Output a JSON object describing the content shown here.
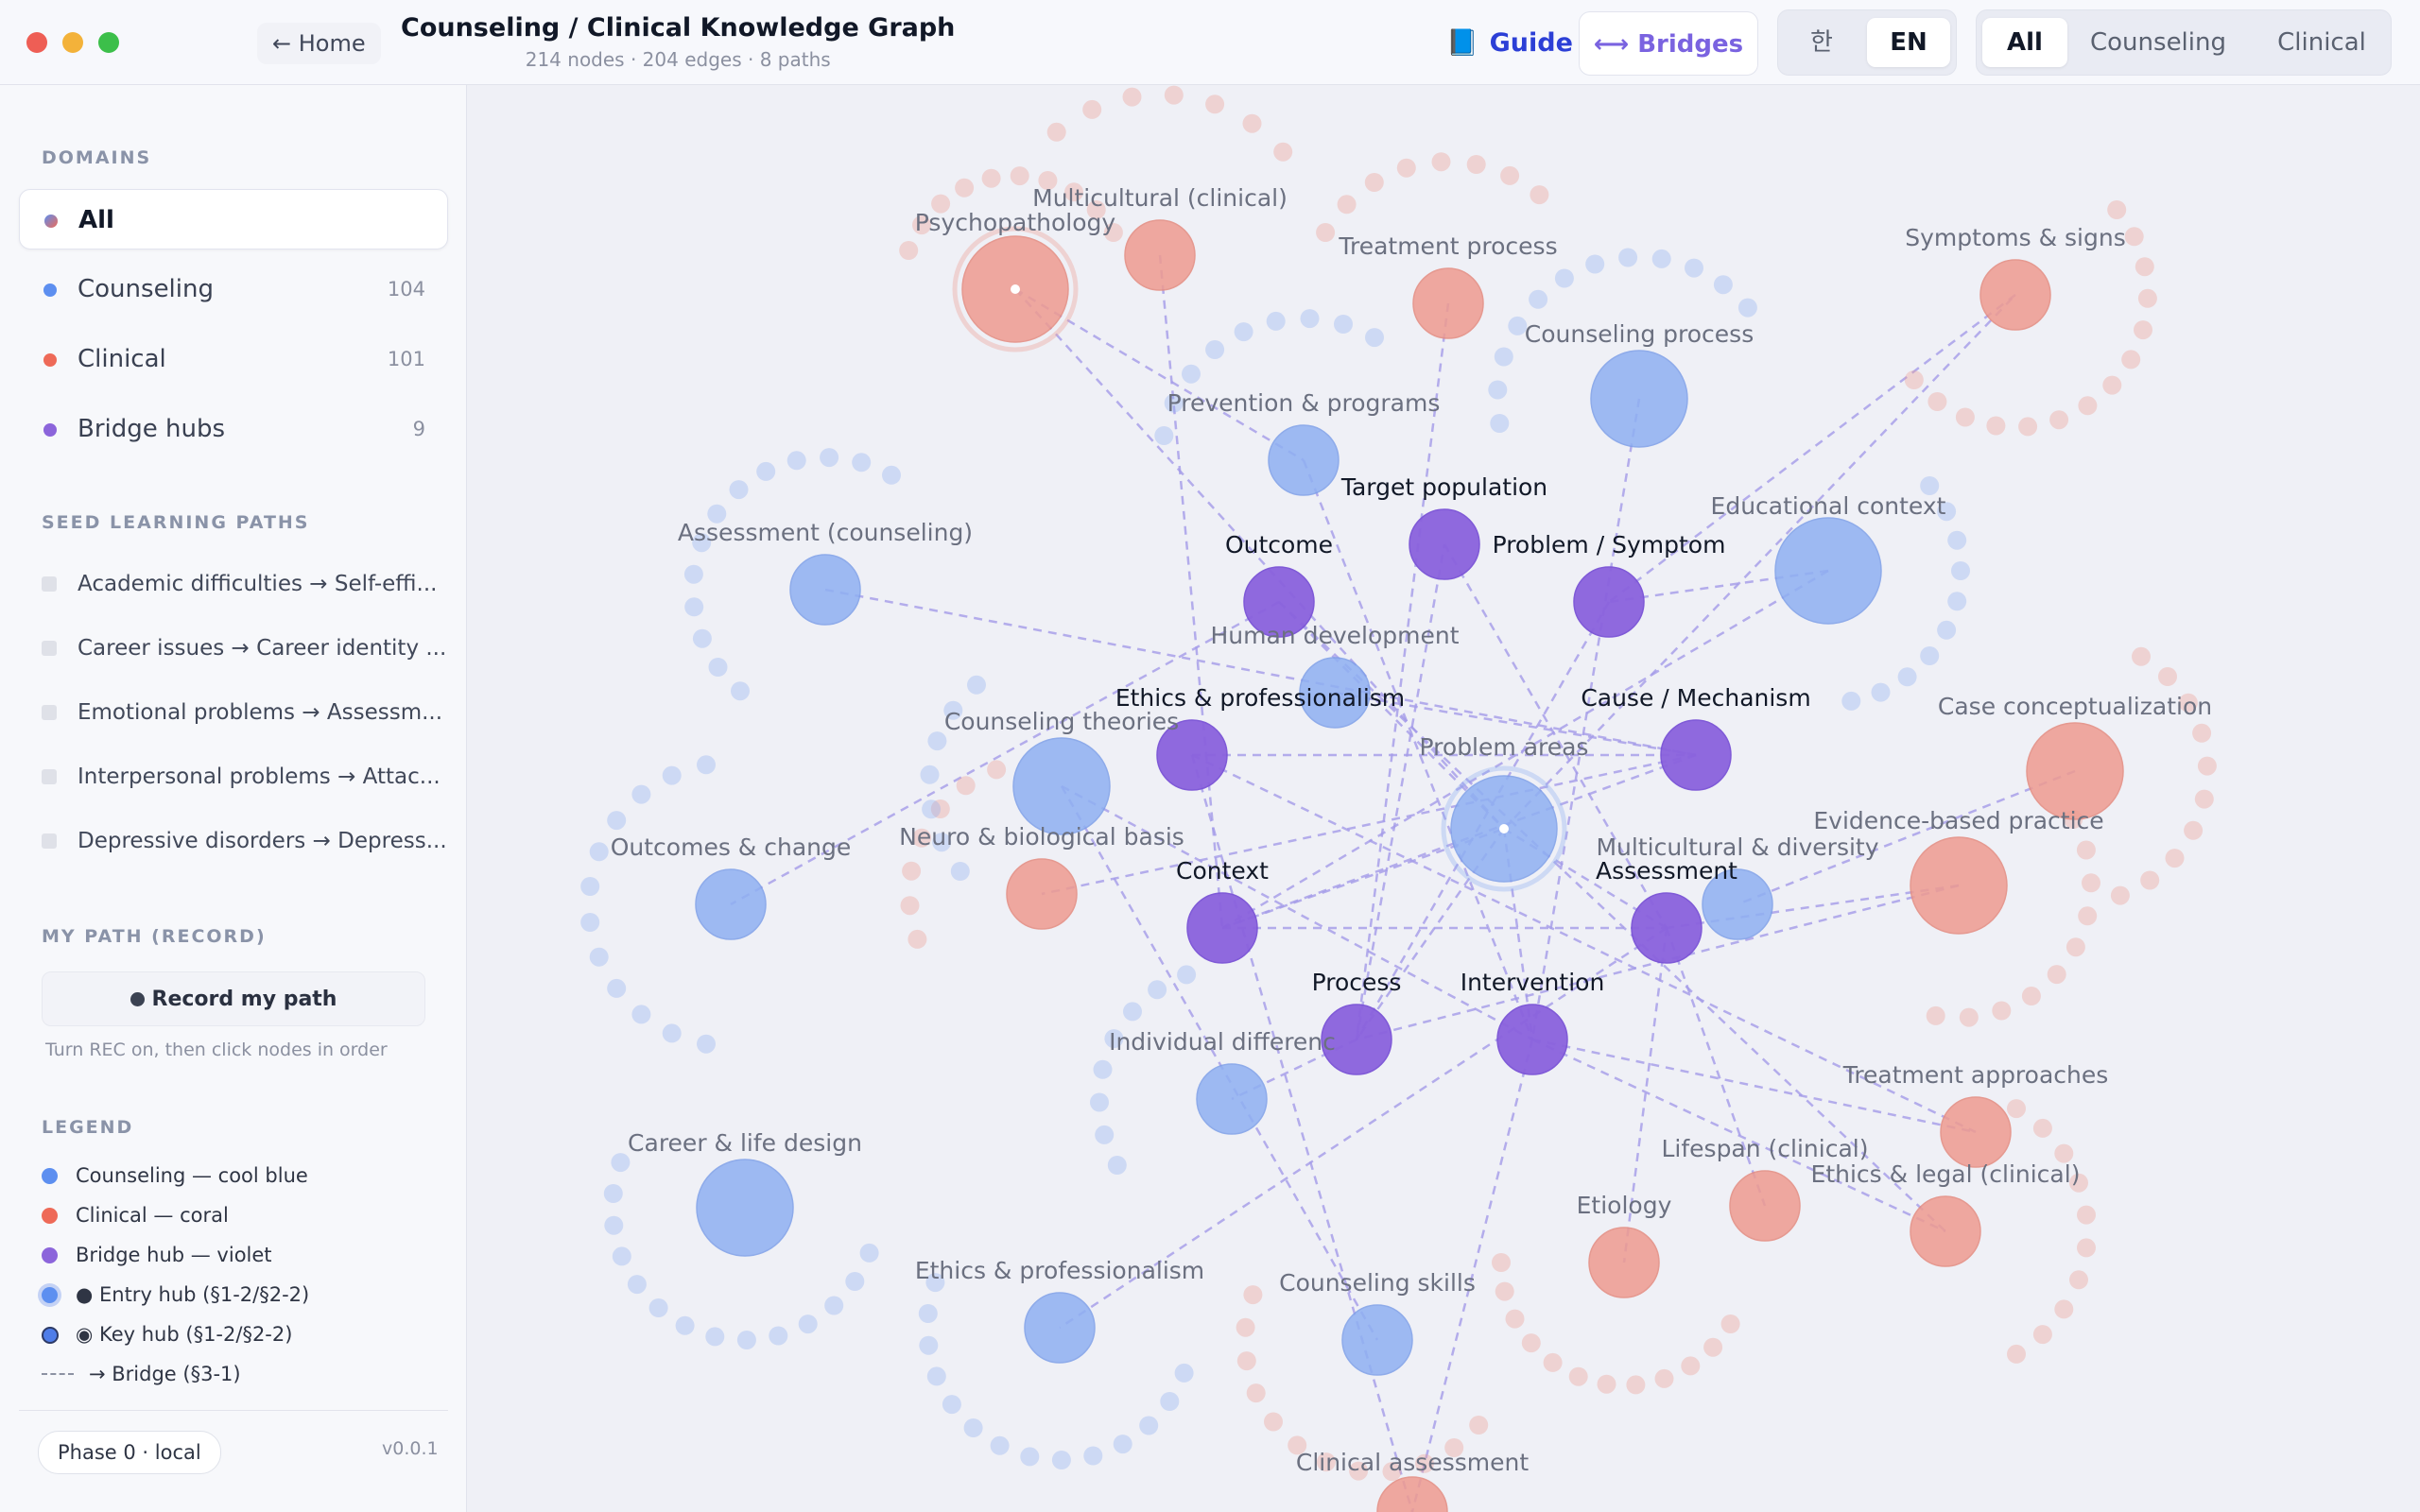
{
  "window": {
    "home_label": "← Home",
    "title": "Counseling / Clinical Knowledge Graph",
    "subtitle": "214 nodes · 204 edges · 8 paths"
  },
  "toolbar": {
    "guide_icon": "book-icon",
    "guide_label": "Guide",
    "bridges_label": "⟷ Bridges",
    "lang_options": [
      "한",
      "EN"
    ],
    "lang_selected": "EN",
    "domain_options": [
      "All",
      "Counseling",
      "Clinical"
    ],
    "domain_selected": "All"
  },
  "sidebar": {
    "domains_title": "DOMAINS",
    "domains": [
      {
        "label": "All",
        "count": "",
        "color": "#8d6fd8"
      },
      {
        "label": "Counseling",
        "count": "104",
        "color": "#5d8ff0"
      },
      {
        "label": "Clinical",
        "count": "101",
        "color": "#ee6a58"
      },
      {
        "label": "Bridge hubs",
        "count": "9",
        "color": "#8c65db"
      }
    ],
    "paths_title": "SEED LEARNING PATHS",
    "paths": [
      "Academic difficulties → Self-effi...",
      "Career issues → Career identity ...",
      "Emotional problems → Assessm...",
      "Interpersonal problems → Attac...",
      "Depressive disorders → Depress..."
    ],
    "record_title": "MY PATH (RECORD)",
    "record_button": "Record my path",
    "record_hint": "Turn REC on, then click nodes in order",
    "legend_title": "LEGEND",
    "legend": [
      "Counseling — cool blue",
      "Clinical — coral",
      "Bridge hub — violet",
      "● Entry hub (§1-2/§2-2)",
      "◉ Key hub (§1-2/§2-2)",
      "→ Bridge (§3-1)"
    ],
    "phase_label": "Phase 0 · local",
    "version": "v0.0.1"
  },
  "colors": {
    "counseling": "#8fb0f2",
    "clinical": "#ee9b90",
    "bridge": "#8a62dd",
    "edge": "#a59ce9"
  },
  "graph": {
    "nodes": [
      {
        "id": "psychopathology",
        "label": "Psychopathology",
        "type": "clinical",
        "size": "xl",
        "hub": "key"
      },
      {
        "id": "multicultural-clinical",
        "label": "Multicultural (clinical)",
        "type": "clinical",
        "size": "m"
      },
      {
        "id": "treatment-process",
        "label": "Treatment process",
        "type": "clinical",
        "size": "m"
      },
      {
        "id": "symptoms-signs",
        "label": "Symptoms & signs",
        "type": "clinical",
        "size": "m"
      },
      {
        "id": "counseling-process",
        "label": "Counseling process",
        "type": "counseling",
        "size": "l"
      },
      {
        "id": "prevention-programs",
        "label": "Prevention & programs",
        "type": "counseling",
        "size": "m"
      },
      {
        "id": "target-population",
        "label": "Target population",
        "type": "bridge",
        "size": "m"
      },
      {
        "id": "educational-context",
        "label": "Educational context",
        "type": "counseling",
        "size": "xl"
      },
      {
        "id": "assessment-counseling",
        "label": "Assessment (counseling)",
        "type": "counseling",
        "size": "m"
      },
      {
        "id": "outcome",
        "label": "Outcome",
        "type": "bridge",
        "size": "m"
      },
      {
        "id": "problem-symptom",
        "label": "Problem / Symptom",
        "type": "bridge",
        "size": "m"
      },
      {
        "id": "human-development",
        "label": "Human development",
        "type": "counseling",
        "size": "m"
      },
      {
        "id": "ethics-professionalism-bridge",
        "label": "Ethics & professionalism",
        "type": "bridge",
        "size": "m"
      },
      {
        "id": "cause-mechanism",
        "label": "Cause / Mechanism",
        "type": "bridge",
        "size": "m"
      },
      {
        "id": "case-conceptualization",
        "label": "Case conceptualization",
        "type": "clinical",
        "size": "l"
      },
      {
        "id": "counseling-theories",
        "label": "Counseling theories",
        "type": "counseling",
        "size": "l"
      },
      {
        "id": "problem-areas",
        "label": "Problem areas",
        "type": "counseling",
        "size": "xl",
        "hub": "key"
      },
      {
        "id": "evidence-based-practice",
        "label": "Evidence-based practice",
        "type": "clinical",
        "size": "l"
      },
      {
        "id": "outcomes-change",
        "label": "Outcomes & change",
        "type": "counseling",
        "size": "m"
      },
      {
        "id": "neuro-biological-basis",
        "label": "Neuro & biological basis",
        "type": "clinical",
        "size": "m"
      },
      {
        "id": "context",
        "label": "Context",
        "type": "bridge",
        "size": "m"
      },
      {
        "id": "multicultural-diversity",
        "label": "Multicultural & diversity",
        "type": "counseling",
        "size": "m"
      },
      {
        "id": "assessment",
        "label": "Assessment",
        "type": "bridge",
        "size": "m"
      },
      {
        "id": "process",
        "label": "Process",
        "type": "bridge",
        "size": "m"
      },
      {
        "id": "intervention",
        "label": "Intervention",
        "type": "bridge",
        "size": "m"
      },
      {
        "id": "individual-differences",
        "label": "Individual differenc",
        "type": "counseling",
        "size": "m"
      },
      {
        "id": "treatment-approaches",
        "label": "Treatment approaches",
        "type": "clinical",
        "size": "m"
      },
      {
        "id": "lifespan-clinical",
        "label": "Lifespan (clinical)",
        "type": "clinical",
        "size": "m"
      },
      {
        "id": "ethics-legal-clinical",
        "label": "Ethics & legal (clinical)",
        "type": "clinical",
        "size": "m"
      },
      {
        "id": "career-life-design",
        "label": "Career & life design",
        "type": "counseling",
        "size": "l"
      },
      {
        "id": "etiology",
        "label": "Etiology",
        "type": "clinical",
        "size": "m"
      },
      {
        "id": "ethics-professionalism",
        "label": "Ethics & professionalism",
        "type": "counseling",
        "size": "m"
      },
      {
        "id": "counseling-skills",
        "label": "Counseling skills",
        "type": "counseling",
        "size": "m"
      },
      {
        "id": "clinical-assessment",
        "label": "Clinical assessment",
        "type": "clinical",
        "size": "m"
      }
    ]
  }
}
